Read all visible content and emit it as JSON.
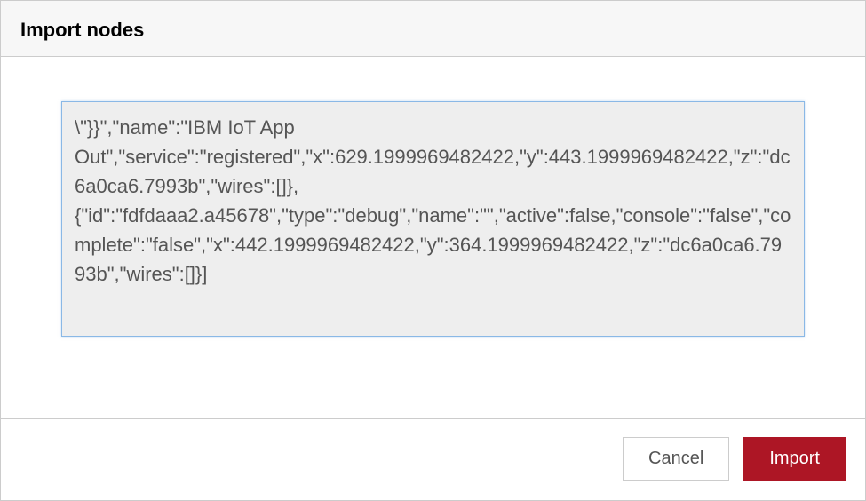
{
  "dialog": {
    "title": "Import nodes",
    "textarea_value": "\\\"}}\",\"name\":\"IBM IoT App Out\",\"service\":\"registered\",\"x\":629.1999969482422,\"y\":443.1999969482422,\"z\":\"dc6a0ca6.7993b\",\"wires\":[]},{\"id\":\"fdfdaaa2.a45678\",\"type\":\"debug\",\"name\":\"\",\"active\":false,\"console\":\"false\",\"complete\":\"false\",\"x\":442.1999969482422,\"y\":364.1999969482422,\"z\":\"dc6a0ca6.7993b\",\"wires\":[]}]",
    "footer": {
      "cancel_label": "Cancel",
      "import_label": "Import"
    }
  }
}
